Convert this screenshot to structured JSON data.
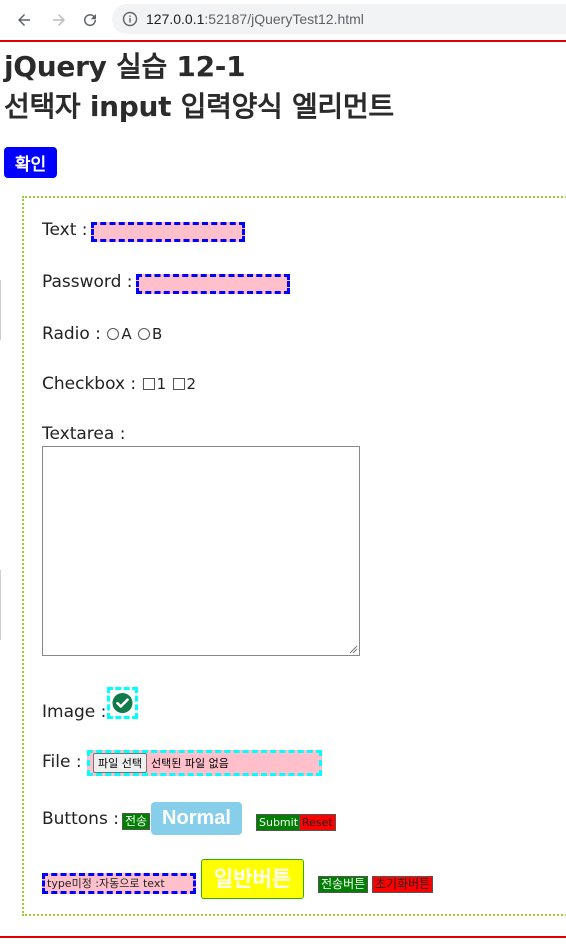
{
  "browser": {
    "url_host": "127.0.0.1",
    "url_rest": ":52187/jQueryTest12.html"
  },
  "page": {
    "title_line1": "jQuery 실습 12-1",
    "title_line2": "선택자 input 입력양식 엘리먼트",
    "confirm_button": "확인"
  },
  "form": {
    "text_label": "Text :",
    "password_label": "Password :",
    "radio_label": "Radio :",
    "radio_options": [
      "A",
      "B"
    ],
    "checkbox_label": "Checkbox :",
    "checkbox_options": [
      "1",
      "2"
    ],
    "textarea_label": "Textarea :",
    "image_label": "Image :",
    "file_label": "File :",
    "file_button": "파일 선택",
    "file_status": "선택된 파일 없음",
    "buttons_label": "Buttons :",
    "send_button": "전송",
    "normal_button": "Normal",
    "submit_button": "Submit",
    "reset_button": "Reset",
    "untyped_input_value": "type미정 :자동으로 text",
    "general_button": "일반버튼",
    "send_button2": "전송버튼",
    "reset_button2": "초기화버튼"
  },
  "colors": {
    "confirm_bg": "#0000ff",
    "input_bg": "#ffc0cb",
    "input_border": "#0000ff",
    "cyan_border": "#00ffff",
    "form_border": "#9acd32",
    "rule": "#e00000",
    "submit_bg": "#008000",
    "reset_bg": "#ff0000",
    "normal_bg": "#87ceeb",
    "general_bg": "#ffff00"
  }
}
